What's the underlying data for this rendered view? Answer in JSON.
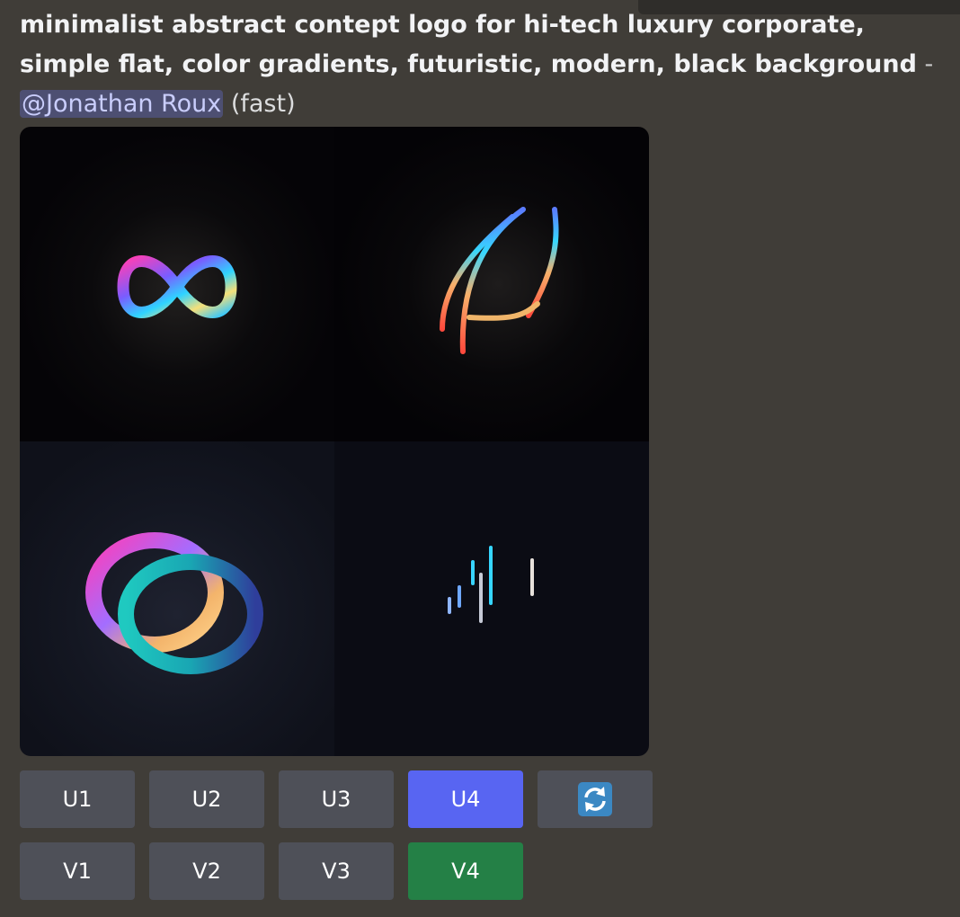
{
  "message": {
    "prompt": "minimalist abstract contept logo for hi-tech luxury corporate, simple flat, color gradients, futuristic, modern, black background",
    "separator": " - ",
    "mention": "@Jonathan Roux",
    "speed": "(fast)"
  },
  "image_grid": {
    "tiles": [
      "infinity-loop-logo",
      "gradient-leaf-logo",
      "interlocking-rings-logo",
      "gradient-bars-logo"
    ]
  },
  "buttons": {
    "upscale": [
      "U1",
      "U2",
      "U3",
      "U4"
    ],
    "variation": [
      "V1",
      "V2",
      "V3",
      "V4"
    ],
    "reroll_icon": "refresh-icon"
  },
  "colors": {
    "background": "#403d38",
    "button_default": "#4e5058",
    "button_selected_upscale": "#5865f2",
    "button_selected_variation": "#248046",
    "mention_bg": "#4d4f72",
    "mention_text": "#c9cdfb"
  }
}
